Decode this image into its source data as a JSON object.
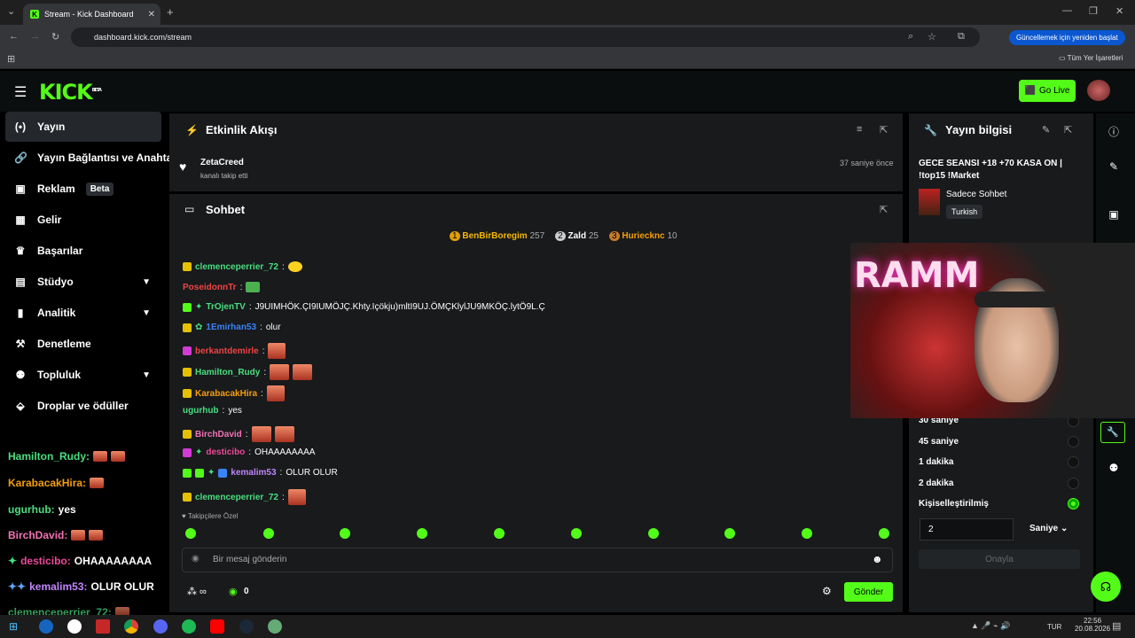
{
  "browser": {
    "tab_title": "Stream - Kick Dashboard",
    "url": "dashboard.kick.com/stream",
    "update_chip": "Güncellemek için yeniden başlat",
    "bookmarks_label": "Tüm Yer İşaretleri"
  },
  "header": {
    "logo": "KICK",
    "logo_badge": "BETA",
    "go_live": "Go Live"
  },
  "sidebar": {
    "items": [
      {
        "label": "Yayın",
        "icon": "broadcast-icon"
      },
      {
        "label": "Yayın Bağlantısı ve Anahta",
        "icon": "link-icon"
      },
      {
        "label": "Reklam",
        "icon": "ad-icon",
        "badge": "Beta"
      },
      {
        "label": "Gelir",
        "icon": "revenue-icon"
      },
      {
        "label": "Başarılar",
        "icon": "trophy-icon"
      },
      {
        "label": "Stüdyo",
        "icon": "studio-icon"
      },
      {
        "label": "Analitik",
        "icon": "analytics-icon"
      },
      {
        "label": "Denetleme",
        "icon": "moderation-icon"
      },
      {
        "label": "Topluluk",
        "icon": "community-icon"
      },
      {
        "label": "Droplar ve ödüller",
        "icon": "drops-icon"
      }
    ]
  },
  "overlay_chat": [
    {
      "user": "Hamilton_Rudy:",
      "text": "",
      "color": "#4ade80"
    },
    {
      "user": "KarabacakHira:",
      "text": "",
      "color": "#f59e0b"
    },
    {
      "user": "ugurhub:",
      "text": "yes",
      "color": "#4ade80"
    },
    {
      "user": "BirchDavid:",
      "text": "",
      "color": "#f472b6"
    },
    {
      "user": "desticibo:",
      "text": "OHAAAAAAAA",
      "color": "#ec4899"
    },
    {
      "user": "kemalim53:",
      "text": "OLUR OLUR",
      "color": "#c084fc"
    },
    {
      "user": "clemenceperrier_72:",
      "text": "",
      "color": "#4ade80"
    }
  ],
  "events": {
    "title": "Etkinlik Akışı",
    "user": "ZetaCreed",
    "action": "kanalı takip etti",
    "time": "37 saniye önce"
  },
  "chat": {
    "title": "Sohbet",
    "leaders": [
      {
        "name": "BenBirBoregim",
        "score": "257",
        "rank": "1"
      },
      {
        "name": "Zald",
        "score": "25",
        "rank": "2"
      },
      {
        "name": "Huriecknc",
        "score": "10",
        "rank": "3"
      }
    ],
    "messages": [
      {
        "user": "clemenceperrier_72",
        "text": "",
        "color": "#4ade80"
      },
      {
        "user": "PoseidonnTr",
        "text": "",
        "color": "#ef4444"
      },
      {
        "user": "TrOjenTV",
        "text": "J9UIMHÖK.ÇI9IUMÖJÇ.Khty.Içökju)mltI9UJ.ÖMÇKlylJU9MKÖÇ.lytÖ9L.Ç",
        "color": "#4ade80"
      },
      {
        "user": "1Emirhan53",
        "text": "olur",
        "color": "#3b82f6"
      },
      {
        "user": "berkantdemirle",
        "text": "",
        "color": "#ef4444"
      },
      {
        "user": "Hamilton_Rudy",
        "text": "",
        "color": "#4ade80"
      },
      {
        "user": "KarabacakHira",
        "text": "",
        "color": "#f59e0b"
      },
      {
        "user": "ugurhub",
        "text": "yes",
        "color": "#4ade80"
      },
      {
        "user": "BirchDavid",
        "text": "",
        "color": "#f472b6"
      },
      {
        "user": "desticibo",
        "text": "OHAAAAAAAA",
        "color": "#ec4899"
      },
      {
        "user": "kemalim53",
        "text": "OLUR OLUR",
        "color": "#c084fc"
      },
      {
        "user": "clemenceperrier_72",
        "text": "",
        "color": "#4ade80"
      }
    ],
    "followers_only": "Takipçilere Özel",
    "input_placeholder": "Bir mesaj gönderin",
    "count": "0",
    "send": "Gönder"
  },
  "stream_info": {
    "title": "Yayın bilgisi",
    "stream_title": "GECE SEANSI +18 +70 KASA ON | !top15 !Market",
    "category": "Sadece Sohbet",
    "language": "Turkish",
    "options": [
      {
        "label": "30 saniye",
        "selected": false
      },
      {
        "label": "45 saniye",
        "selected": false
      },
      {
        "label": "1 dakika",
        "selected": false
      },
      {
        "label": "2 dakika",
        "selected": false
      },
      {
        "label": "Kişiselleştirilmiş",
        "selected": true
      }
    ],
    "custom_value": "2",
    "unit": "Saniye",
    "confirm": "Onayla"
  },
  "taskbar": {
    "lang": "TUR",
    "time": "22:56",
    "date": "20.08.2026"
  }
}
